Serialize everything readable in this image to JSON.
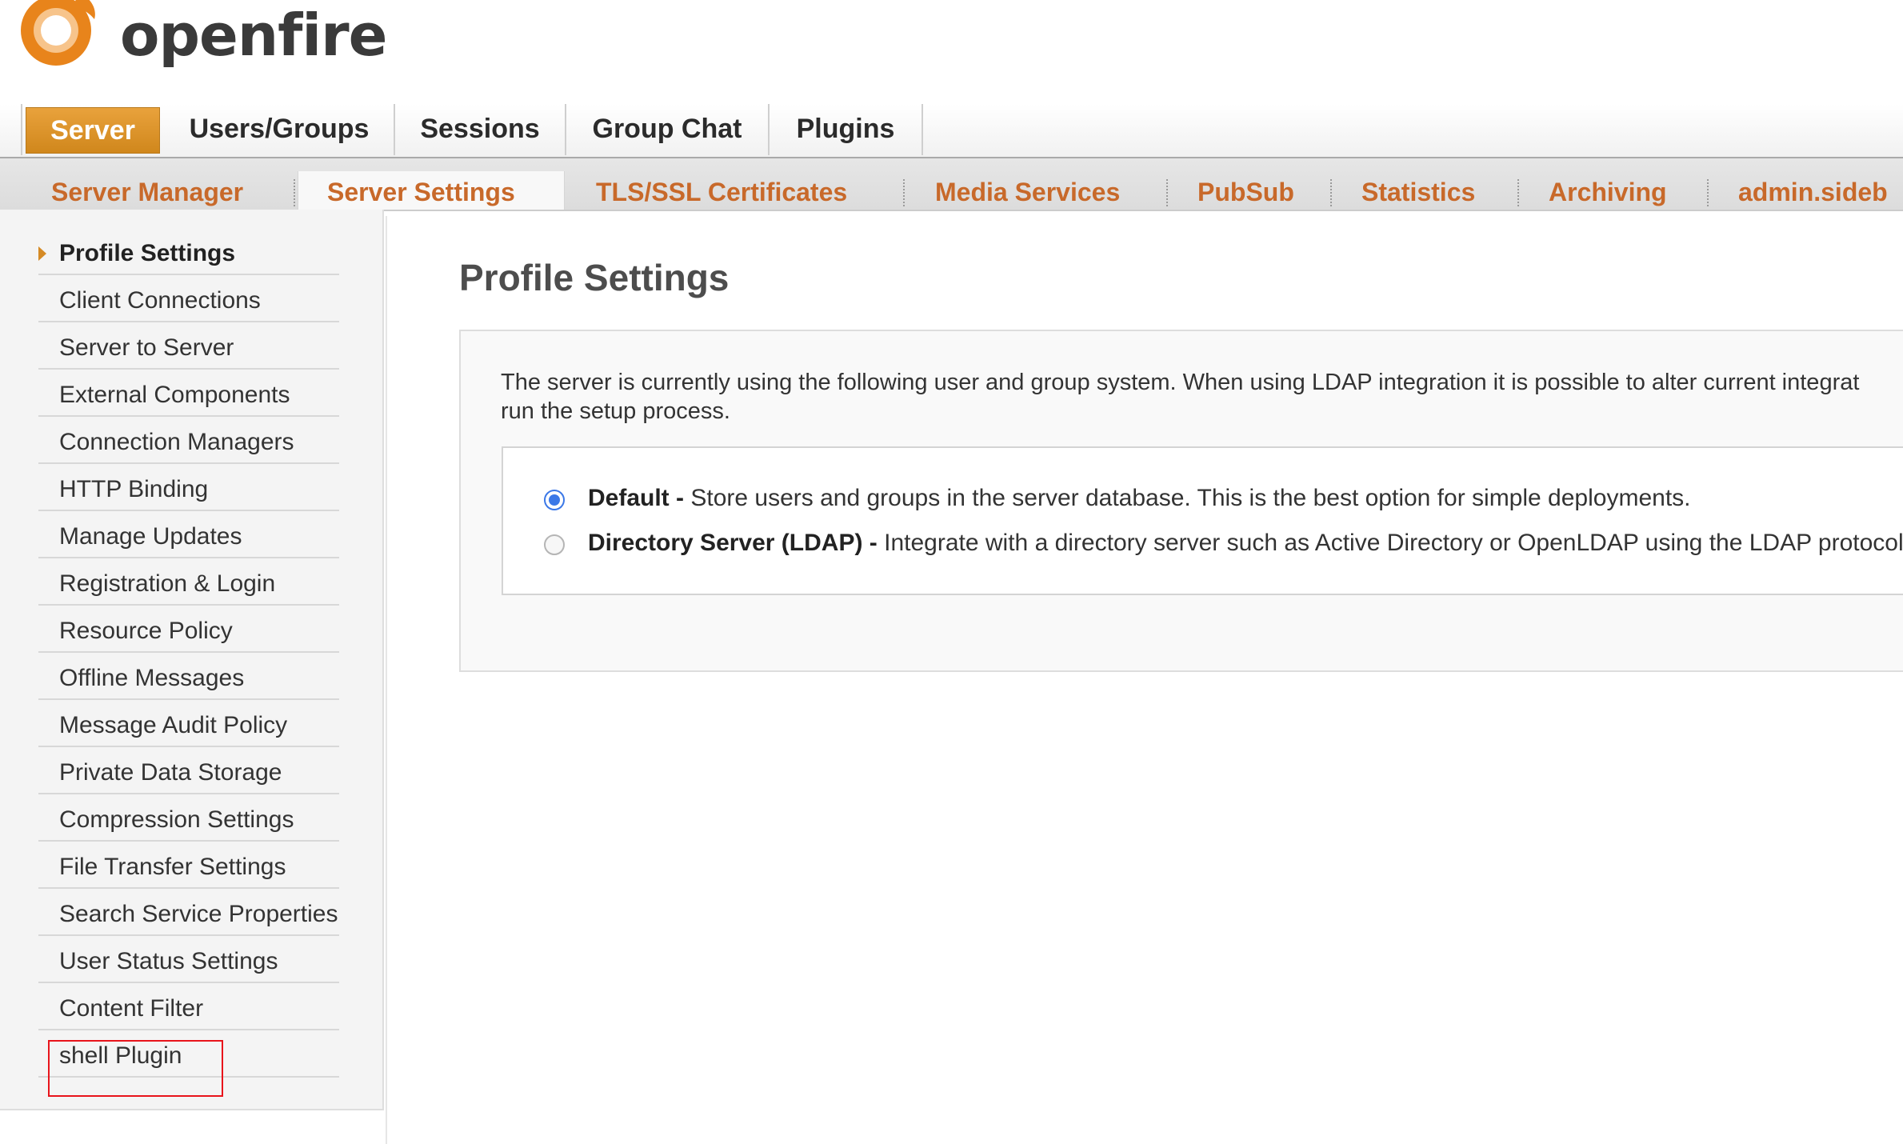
{
  "logo": {
    "text": "openfire",
    "tm": "™",
    "brand_color": "#e8841b"
  },
  "main_tabs": [
    {
      "label": "Server",
      "active": true
    },
    {
      "label": "Users/Groups",
      "active": false
    },
    {
      "label": "Sessions",
      "active": false
    },
    {
      "label": "Group Chat",
      "active": false
    },
    {
      "label": "Plugins",
      "active": false
    }
  ],
  "sub_tabs": [
    {
      "label": "Server Manager",
      "active": false
    },
    {
      "label": "Server Settings",
      "active": true
    },
    {
      "label": "TLS/SSL Certificates",
      "active": false
    },
    {
      "label": "Media Services",
      "active": false
    },
    {
      "label": "PubSub",
      "active": false
    },
    {
      "label": "Statistics",
      "active": false
    },
    {
      "label": "Archiving",
      "active": false
    },
    {
      "label": "admin.sideb",
      "active": false
    }
  ],
  "sidebar": {
    "items": [
      {
        "label": "Profile Settings",
        "active": true
      },
      {
        "label": "Client Connections",
        "active": false
      },
      {
        "label": "Server to Server",
        "active": false
      },
      {
        "label": "External Components",
        "active": false
      },
      {
        "label": "Connection Managers",
        "active": false
      },
      {
        "label": "HTTP Binding",
        "active": false
      },
      {
        "label": "Manage Updates",
        "active": false
      },
      {
        "label": "Registration & Login",
        "active": false
      },
      {
        "label": "Resource Policy",
        "active": false
      },
      {
        "label": "Offline Messages",
        "active": false
      },
      {
        "label": "Message Audit Policy",
        "active": false
      },
      {
        "label": "Private Data Storage",
        "active": false
      },
      {
        "label": "Compression Settings",
        "active": false
      },
      {
        "label": "File Transfer Settings",
        "active": false
      },
      {
        "label": "Search Service Properties",
        "active": false
      },
      {
        "label": "User Status Settings",
        "active": false
      },
      {
        "label": "Content Filter",
        "active": false
      },
      {
        "label": "shell Plugin",
        "active": false
      }
    ]
  },
  "main": {
    "title": "Profile Settings",
    "intro_line1": "The server is currently using the following user and group system. When using LDAP integration it is possible to alter current integrat",
    "intro_line2": "run the setup process.",
    "options": [
      {
        "name": "Default",
        "sep": " - ",
        "description": "Store users and groups in the server database. This is the best option for simple deployments.",
        "selected": true
      },
      {
        "name": "Directory Server (LDAP)",
        "sep": " - ",
        "description": "Integrate with a directory server such as Active Directory or OpenLDAP using the LDAP protocol",
        "selected": false
      }
    ]
  },
  "colors": {
    "accent": "#d0871c",
    "subtab_text": "#c8692a",
    "radio_selected": "#3b78e7",
    "highlight_box": "#e8141b"
  }
}
